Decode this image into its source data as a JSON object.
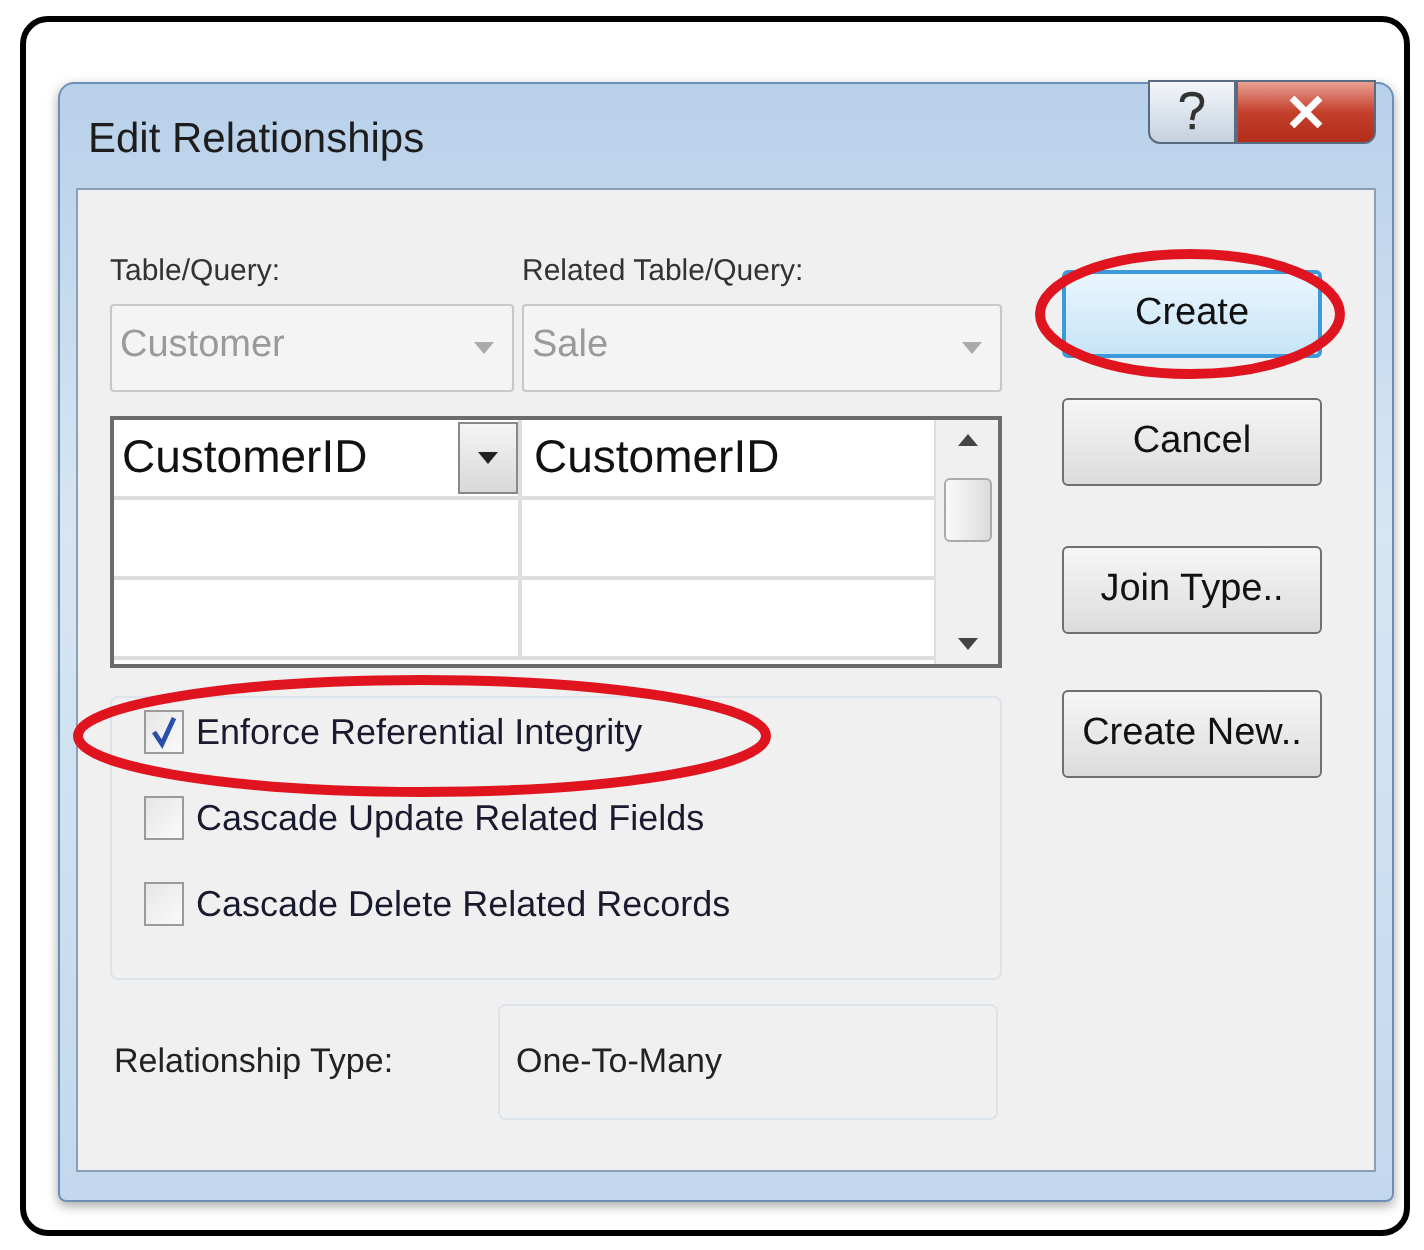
{
  "window": {
    "title": "Edit Relationships"
  },
  "table_query": {
    "label": "Table/Query:",
    "value": "Customer",
    "disabled": true
  },
  "related_table_query": {
    "label": "Related Table/Query:",
    "value": "Sale",
    "disabled": true
  },
  "field_grid": {
    "rows": [
      {
        "cells": [
          "CustomerID",
          "CustomerID"
        ]
      }
    ]
  },
  "options": [
    {
      "label": "Enforce Referential Integrity",
      "checked": true,
      "highlighted": true
    },
    {
      "label": "Cascade Update Related Fields",
      "checked": false,
      "highlighted": false
    },
    {
      "label": "Cascade Delete Related Records",
      "checked": false,
      "highlighted": false
    }
  ],
  "relationship_type": {
    "label": "Relationship Type:",
    "value": "One-To-Many"
  },
  "buttons": [
    {
      "label": "Create",
      "default": true,
      "highlighted": true
    },
    {
      "label": "Cancel",
      "default": false,
      "highlighted": false
    },
    {
      "label": "Join Type..",
      "default": false,
      "highlighted": false
    },
    {
      "label": "Create New..",
      "default": false,
      "highlighted": false
    }
  ]
}
